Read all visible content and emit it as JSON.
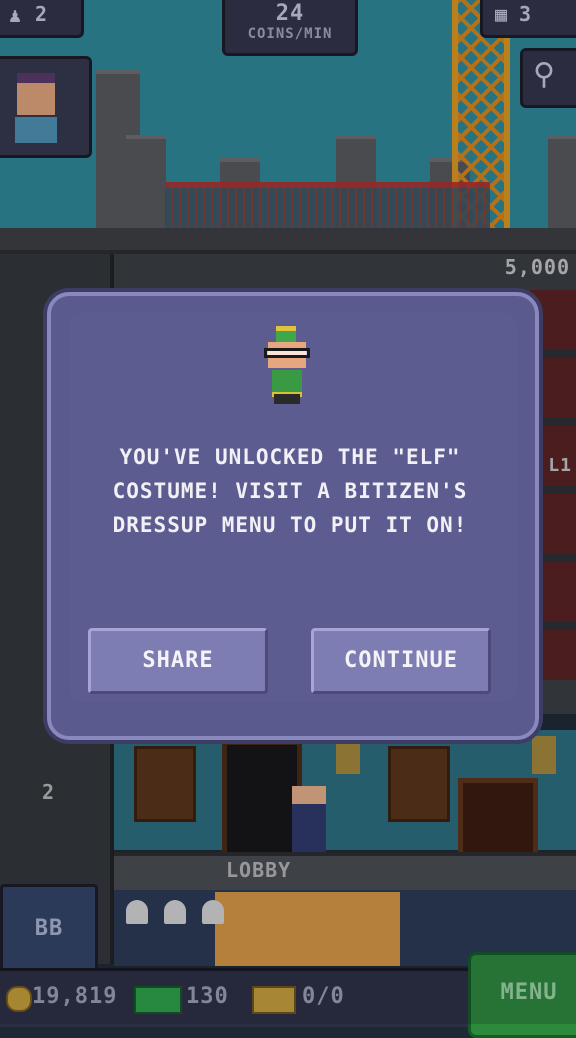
{
  "hud": {
    "population": "2",
    "coins_per_min_value": "24",
    "coins_per_min_label": "COINS/MIN",
    "floor_count": "3"
  },
  "tower": {
    "next_floor_cost": "5,000",
    "right_floor_tag": "L1",
    "elevator_floor_number": "2",
    "lobby_label": "LOBBY",
    "bb_label": "BB"
  },
  "bottom_bar": {
    "coins": "19,819",
    "bux": "130",
    "tickets": "0/0",
    "menu_label": "MENU"
  },
  "dialog": {
    "message": "YOU'VE UNLOCKED THE \"ELF\" COSTUME! VISIT A BITIZEN'S DRESSUP MENU TO PUT IT ON!",
    "share_label": "SHARE",
    "continue_label": "CONTINUE"
  },
  "colors": {
    "dialog_bg": "#5b5a8e",
    "button_bg": "#7d7cb3",
    "menu_green": "#2c8a3c",
    "sky": "#2f8a9a"
  },
  "icons": [
    "person-icon",
    "floors-icon",
    "search-icon",
    "coin-icon",
    "bux-icon",
    "ticket-icon",
    "elf-avatar-icon"
  ]
}
